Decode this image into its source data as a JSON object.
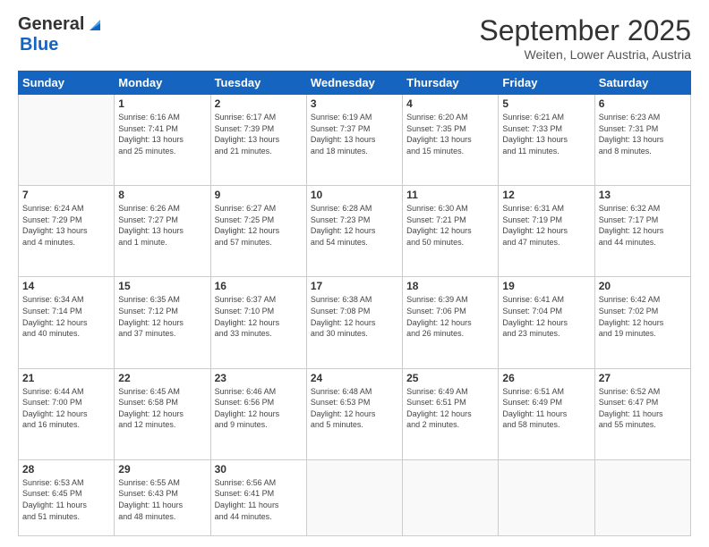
{
  "header": {
    "logo_general": "General",
    "logo_blue": "Blue",
    "month": "September 2025",
    "location": "Weiten, Lower Austria, Austria"
  },
  "days_of_week": [
    "Sunday",
    "Monday",
    "Tuesday",
    "Wednesday",
    "Thursday",
    "Friday",
    "Saturday"
  ],
  "weeks": [
    [
      {
        "day": "",
        "info": ""
      },
      {
        "day": "1",
        "info": "Sunrise: 6:16 AM\nSunset: 7:41 PM\nDaylight: 13 hours\nand 25 minutes."
      },
      {
        "day": "2",
        "info": "Sunrise: 6:17 AM\nSunset: 7:39 PM\nDaylight: 13 hours\nand 21 minutes."
      },
      {
        "day": "3",
        "info": "Sunrise: 6:19 AM\nSunset: 7:37 PM\nDaylight: 13 hours\nand 18 minutes."
      },
      {
        "day": "4",
        "info": "Sunrise: 6:20 AM\nSunset: 7:35 PM\nDaylight: 13 hours\nand 15 minutes."
      },
      {
        "day": "5",
        "info": "Sunrise: 6:21 AM\nSunset: 7:33 PM\nDaylight: 13 hours\nand 11 minutes."
      },
      {
        "day": "6",
        "info": "Sunrise: 6:23 AM\nSunset: 7:31 PM\nDaylight: 13 hours\nand 8 minutes."
      }
    ],
    [
      {
        "day": "7",
        "info": "Sunrise: 6:24 AM\nSunset: 7:29 PM\nDaylight: 13 hours\nand 4 minutes."
      },
      {
        "day": "8",
        "info": "Sunrise: 6:26 AM\nSunset: 7:27 PM\nDaylight: 13 hours\nand 1 minute."
      },
      {
        "day": "9",
        "info": "Sunrise: 6:27 AM\nSunset: 7:25 PM\nDaylight: 12 hours\nand 57 minutes."
      },
      {
        "day": "10",
        "info": "Sunrise: 6:28 AM\nSunset: 7:23 PM\nDaylight: 12 hours\nand 54 minutes."
      },
      {
        "day": "11",
        "info": "Sunrise: 6:30 AM\nSunset: 7:21 PM\nDaylight: 12 hours\nand 50 minutes."
      },
      {
        "day": "12",
        "info": "Sunrise: 6:31 AM\nSunset: 7:19 PM\nDaylight: 12 hours\nand 47 minutes."
      },
      {
        "day": "13",
        "info": "Sunrise: 6:32 AM\nSunset: 7:17 PM\nDaylight: 12 hours\nand 44 minutes."
      }
    ],
    [
      {
        "day": "14",
        "info": "Sunrise: 6:34 AM\nSunset: 7:14 PM\nDaylight: 12 hours\nand 40 minutes."
      },
      {
        "day": "15",
        "info": "Sunrise: 6:35 AM\nSunset: 7:12 PM\nDaylight: 12 hours\nand 37 minutes."
      },
      {
        "day": "16",
        "info": "Sunrise: 6:37 AM\nSunset: 7:10 PM\nDaylight: 12 hours\nand 33 minutes."
      },
      {
        "day": "17",
        "info": "Sunrise: 6:38 AM\nSunset: 7:08 PM\nDaylight: 12 hours\nand 30 minutes."
      },
      {
        "day": "18",
        "info": "Sunrise: 6:39 AM\nSunset: 7:06 PM\nDaylight: 12 hours\nand 26 minutes."
      },
      {
        "day": "19",
        "info": "Sunrise: 6:41 AM\nSunset: 7:04 PM\nDaylight: 12 hours\nand 23 minutes."
      },
      {
        "day": "20",
        "info": "Sunrise: 6:42 AM\nSunset: 7:02 PM\nDaylight: 12 hours\nand 19 minutes."
      }
    ],
    [
      {
        "day": "21",
        "info": "Sunrise: 6:44 AM\nSunset: 7:00 PM\nDaylight: 12 hours\nand 16 minutes."
      },
      {
        "day": "22",
        "info": "Sunrise: 6:45 AM\nSunset: 6:58 PM\nDaylight: 12 hours\nand 12 minutes."
      },
      {
        "day": "23",
        "info": "Sunrise: 6:46 AM\nSunset: 6:56 PM\nDaylight: 12 hours\nand 9 minutes."
      },
      {
        "day": "24",
        "info": "Sunrise: 6:48 AM\nSunset: 6:53 PM\nDaylight: 12 hours\nand 5 minutes."
      },
      {
        "day": "25",
        "info": "Sunrise: 6:49 AM\nSunset: 6:51 PM\nDaylight: 12 hours\nand 2 minutes."
      },
      {
        "day": "26",
        "info": "Sunrise: 6:51 AM\nSunset: 6:49 PM\nDaylight: 11 hours\nand 58 minutes."
      },
      {
        "day": "27",
        "info": "Sunrise: 6:52 AM\nSunset: 6:47 PM\nDaylight: 11 hours\nand 55 minutes."
      }
    ],
    [
      {
        "day": "28",
        "info": "Sunrise: 6:53 AM\nSunset: 6:45 PM\nDaylight: 11 hours\nand 51 minutes."
      },
      {
        "day": "29",
        "info": "Sunrise: 6:55 AM\nSunset: 6:43 PM\nDaylight: 11 hours\nand 48 minutes."
      },
      {
        "day": "30",
        "info": "Sunrise: 6:56 AM\nSunset: 6:41 PM\nDaylight: 11 hours\nand 44 minutes."
      },
      {
        "day": "",
        "info": ""
      },
      {
        "day": "",
        "info": ""
      },
      {
        "day": "",
        "info": ""
      },
      {
        "day": "",
        "info": ""
      }
    ]
  ]
}
